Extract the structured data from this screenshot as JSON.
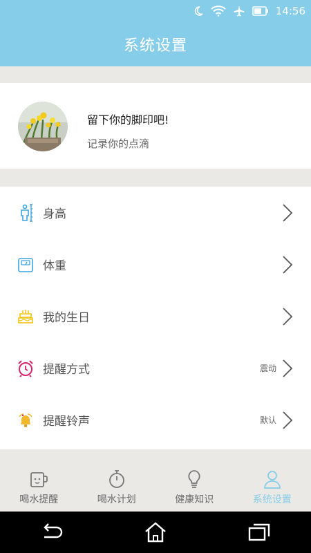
{
  "status_bar": {
    "time": "14:56"
  },
  "header": {
    "title": "系统设置"
  },
  "profile": {
    "title": "留下你的脚印吧!",
    "subtitle": "记录你的点滴"
  },
  "settings": [
    {
      "label": "身高",
      "value": "",
      "icon": "height-icon"
    },
    {
      "label": "体重",
      "value": "",
      "icon": "scale-icon"
    },
    {
      "label": "我的生日",
      "value": "",
      "icon": "birthday-cake-icon"
    },
    {
      "label": "提醒方式",
      "value": "震动",
      "icon": "alarm-clock-icon"
    },
    {
      "label": "提醒铃声",
      "value": "默认",
      "icon": "bell-icon"
    }
  ],
  "tabs": [
    {
      "label": "喝水提醒",
      "icon": "cup-icon",
      "active": false
    },
    {
      "label": "喝水计划",
      "icon": "stopwatch-icon",
      "active": false
    },
    {
      "label": "健康知识",
      "icon": "lightbulb-icon",
      "active": false
    },
    {
      "label": "系统设置",
      "icon": "user-icon",
      "active": true
    }
  ],
  "colors": {
    "accent": "#86cdea",
    "divider": "#ebe9e6"
  }
}
